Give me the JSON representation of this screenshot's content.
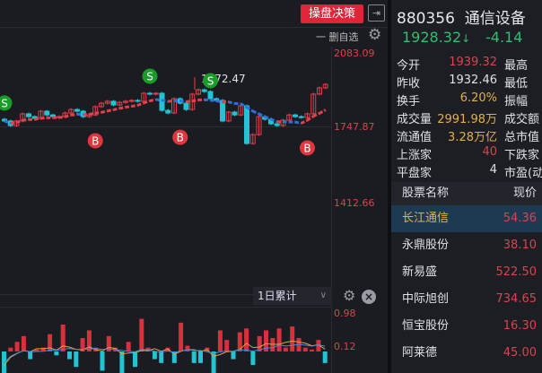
{
  "toolbar": {
    "decision_label": "操盘决策",
    "collapse_icon": "collapse-right-icon",
    "remove_watch_label": "一 删自选"
  },
  "chart": {
    "y_labels": [
      "2083.09",
      "1747.87",
      "1412.66"
    ],
    "price_max": 2083.09,
    "price_mid": 1747.87,
    "price_min": 1412.66,
    "high_annotation": "1972.47",
    "colors": {
      "up": "#e0414c",
      "down": "#22c4d3",
      "ma": "#e0414c",
      "ma_down": "#2f6fe0",
      "buy": "#e0373f",
      "sell": "#1a9c2b"
    },
    "closes": [
      1773,
      1752,
      1773,
      1806,
      1793,
      1785,
      1818,
      1801,
      1793,
      1793,
      1810,
      1826,
      1818,
      1793,
      1801,
      1839,
      1855,
      1864,
      1847,
      1859,
      1864,
      1868,
      1864,
      1901,
      1897,
      1901,
      1822,
      1810,
      1876,
      1855,
      1826,
      1897,
      1917,
      1909,
      1876,
      1868,
      1773,
      1814,
      1801,
      1843,
      1669,
      1710,
      1793,
      1781,
      1760,
      1752,
      1777,
      1801,
      1793,
      1789,
      1806,
      1897,
      1926,
      1942
    ],
    "signals": [
      {
        "i": 0,
        "type": "S"
      },
      {
        "i": 24,
        "type": "S"
      },
      {
        "i": 34,
        "type": "S"
      },
      {
        "i": 15,
        "type": "B"
      },
      {
        "i": 29,
        "type": "B"
      },
      {
        "i": 50,
        "type": "B"
      }
    ]
  },
  "volume_panel": {
    "period_select": "1日累计",
    "y_labels": [
      "0.98",
      "0.12"
    ],
    "max": 0.98,
    "values": [
      -0.6,
      0.1,
      0.25,
      0.4,
      -0.2,
      0.05,
      0.1,
      0.45,
      -0.1,
      0.7,
      -0.2,
      -0.4,
      0.35,
      0.55,
      0.1,
      -0.5,
      0.4,
      0.1,
      -0.6,
      0.25,
      -0.4,
      0.85,
      0.1,
      -0.2,
      -0.3,
      0.1,
      -0.3,
      0.75,
      0.15,
      -0.3,
      -0.3,
      0.1,
      -0.7,
      0.55,
      0.3,
      -0.2,
      0.5,
      0.6,
      -0.35,
      0.4,
      0.55,
      0.35,
      0.6,
      0.1,
      0.65,
      0.35,
      0.1,
      0.05,
      0.3,
      -0.3
    ]
  },
  "quote": {
    "code": "880356",
    "name": "通信设备",
    "price": "1928.32",
    "arrow": "↓",
    "change": "-4.14",
    "rows": [
      {
        "k": "今开",
        "v": "1939.32",
        "c": "#e0414c",
        "k2": "最高"
      },
      {
        "k": "昨收",
        "v": "1932.46",
        "c": "#dfe1e6",
        "k2": "最低"
      },
      {
        "k": "换手",
        "v": "6.20%",
        "c": "#e2b04a",
        "k2": "振幅"
      },
      {
        "k": "成交量",
        "v": "2991.98万",
        "c": "#e2b04a",
        "k2": "成交额"
      },
      {
        "k": "流通值",
        "v": "3.28万亿",
        "c": "#e2b04a",
        "k2": "总市值"
      },
      {
        "k": "上涨家",
        "v": "40",
        "c": "#e0414c",
        "k2": "下跌家"
      },
      {
        "k": "平盘家",
        "v": "4",
        "c": "#dfe1e6",
        "k2": "市盈(动"
      }
    ]
  },
  "stock_list": {
    "headers": [
      "股票名称",
      "现价"
    ],
    "items": [
      {
        "name": "长江通信",
        "price": "54.36"
      },
      {
        "name": "永鼎股份",
        "price": "38.10"
      },
      {
        "name": "新易盛",
        "price": "522.50"
      },
      {
        "name": "中际旭创",
        "price": "734.65"
      },
      {
        "name": "恒宝股份",
        "price": "16.30"
      },
      {
        "name": "阿莱德",
        "price": "45.00"
      }
    ]
  }
}
